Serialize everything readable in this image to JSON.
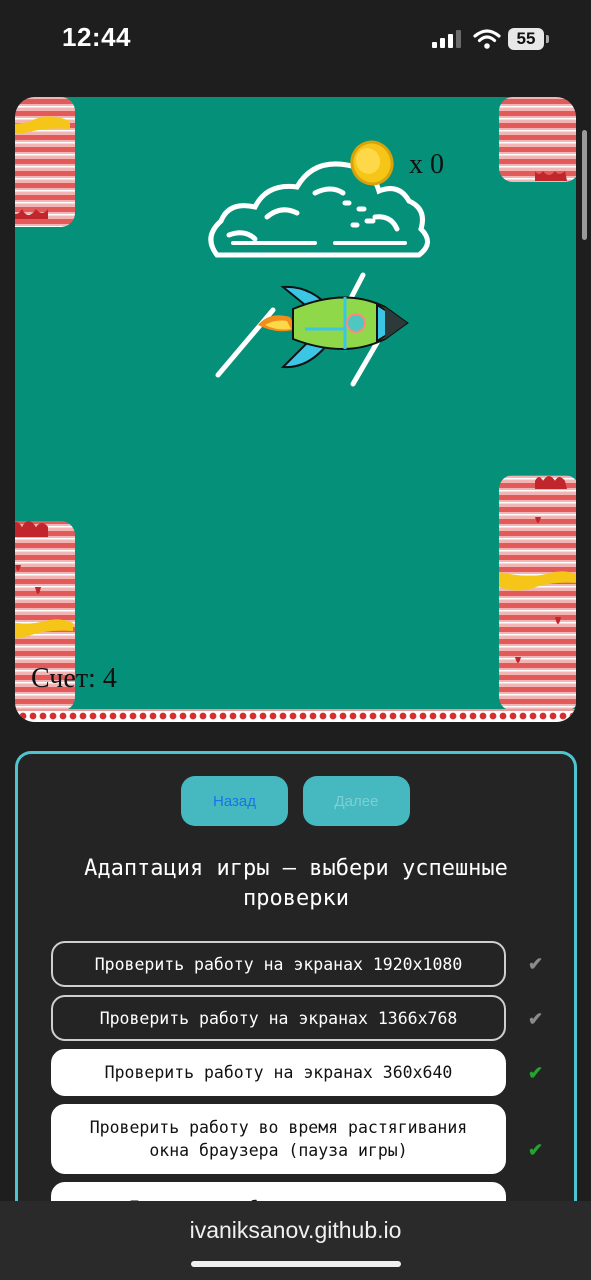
{
  "status_bar": {
    "time": "12:44",
    "battery": "55"
  },
  "game": {
    "coin_counter": "x 0",
    "score": "Счет: 4",
    "colors": {
      "background": "#059079",
      "pancake": "#e85a5a",
      "syrup": "#f5c518"
    }
  },
  "quiz": {
    "back_label": "Назад",
    "next_label": "Далее",
    "title": "Адаптация игры – выбери успешные проверки",
    "options": [
      {
        "label": "Проверить работу на экранах 1920x1080",
        "selected": false,
        "check": "✔"
      },
      {
        "label": "Проверить работу на экранах 1366x768",
        "selected": false,
        "check": "✔"
      },
      {
        "label": "Проверить работу на экранах 360x640",
        "selected": true,
        "check": "✔"
      },
      {
        "label": "Проверить работу во время растягивания окна браузера (пауза игры)",
        "selected": true,
        "check": "✔"
      },
      {
        "label": "Проверить работу игры во время",
        "selected": true,
        "check": ""
      }
    ]
  },
  "browser": {
    "url": "ivaniksanov.github.io"
  }
}
